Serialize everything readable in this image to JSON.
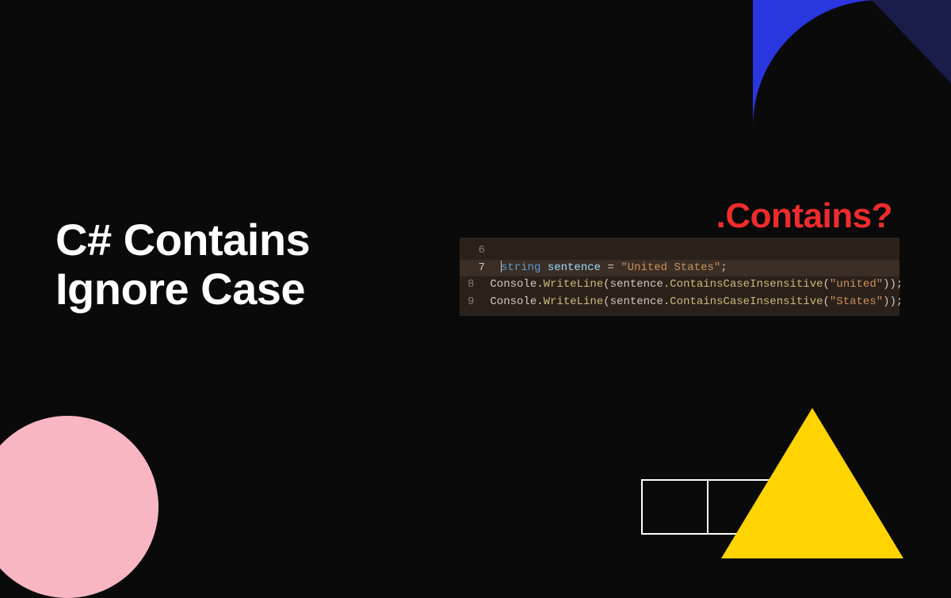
{
  "title_line1": "C# Contains",
  "title_line2": "Ignore Case",
  "subtitle": ".Contains?",
  "editor": {
    "lines": [
      {
        "num": "6",
        "code_html": ""
      },
      {
        "num": "7",
        "code_html": "<span class='cursor'></span><span class='kw'>string</span><span class='pln'> </span><span class='var'>sentence</span><span class='pln'> </span><span class='op'>=</span><span class='pln'> </span><span class='str'>\"United States\"</span><span class='pln'>;</span>"
      },
      {
        "num": "8",
        "code_html": "<span class='pln'>Console.</span><span class='typ'>WriteLine</span><span class='pln'>(sentence.</span><span class='typ'>ContainsCaseInsensitive</span><span class='pln'>(</span><span class='str'>\"united\"</span><span class='pln'>));</span>"
      },
      {
        "num": "9",
        "code_html": "<span class='pln'>Console.</span><span class='typ'>WriteLine</span><span class='pln'>(sentence.</span><span class='typ'>ContainsCaseInsensitive</span><span class='pln'>(</span><span class='str'>\"States\"</span><span class='pln'>));</span>"
      }
    ],
    "highlighted_line_num": "7"
  },
  "shapes": {
    "blue_quarter_color": "#2a36e0",
    "pink_circle_color": "#f8b6c2",
    "yellow_triangle_color": "#ffd400",
    "navy_triangle_color": "#1a1d4a"
  }
}
